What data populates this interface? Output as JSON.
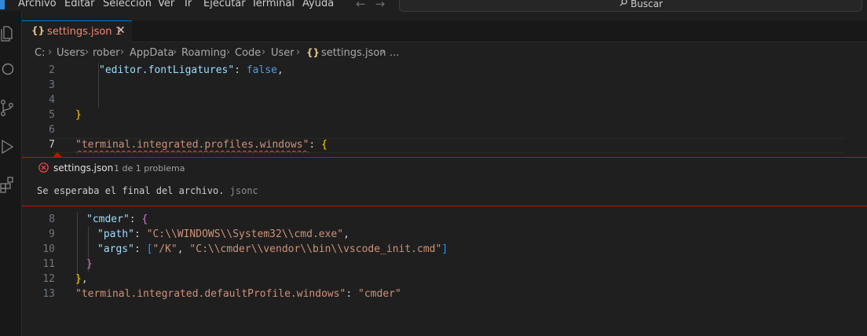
{
  "menubar": {
    "items": [
      "Archivo",
      "Editar",
      "Selección",
      "Ver",
      "Ir",
      "Ejecutar",
      "Terminal",
      "Ayuda"
    ]
  },
  "nav": {
    "back_icon": "arrow-left-icon",
    "forward_icon": "arrow-right-icon"
  },
  "search": {
    "label": "Buscar",
    "icon": "search-icon"
  },
  "activitybar": {
    "icons": [
      "files-icon",
      "search-icon",
      "source-control-icon",
      "run-debug-icon",
      "extensions-icon"
    ]
  },
  "tab": {
    "braces": "{}",
    "name": "settings.json 1",
    "close": "✕"
  },
  "breadcrumb": {
    "parts": [
      "C:",
      "Users",
      "rober",
      "AppData",
      "Roaming",
      "Code",
      "User"
    ],
    "file_braces": "{}",
    "file": "settings.json",
    "more": "..."
  },
  "editor": {
    "lines": [
      {
        "n": "2",
        "tokens": [
          [
            "k",
            "\"editor.fontLigatures\""
          ],
          [
            "p",
            ": "
          ],
          [
            "kw",
            "false"
          ],
          [
            "p",
            ","
          ]
        ]
      },
      {
        "n": "3",
        "tokens": []
      },
      {
        "n": "4",
        "tokens": []
      },
      {
        "n": "5",
        "tokens": [
          [
            "b1",
            "}"
          ]
        ]
      },
      {
        "n": "6",
        "tokens": []
      },
      {
        "n": "7",
        "tokens": [
          [
            "s",
            "\"terminal.integrated.profiles.windows\""
          ],
          [
            "p",
            ": "
          ],
          [
            "b1",
            "{"
          ]
        ]
      },
      {
        "n": "8",
        "tokens": [
          [
            "k",
            "\"cmder\""
          ],
          [
            "p",
            ": "
          ],
          [
            "b2",
            "{"
          ]
        ]
      },
      {
        "n": "9",
        "tokens": [
          [
            "k",
            "\"path\""
          ],
          [
            "p",
            ": "
          ],
          [
            "s",
            "\"C:\\\\WINDOWS\\\\System32\\\\cmd.exe\""
          ],
          [
            "p",
            ","
          ]
        ]
      },
      {
        "n": "10",
        "tokens": [
          [
            "k",
            "\"args\""
          ],
          [
            "p",
            ": "
          ],
          [
            "b3",
            "["
          ],
          [
            "s",
            "\"/K\""
          ],
          [
            "p",
            ", "
          ],
          [
            "s",
            "\"C:\\\\cmder\\\\vendor\\\\bin\\\\vscode_init.cmd\""
          ],
          [
            "b3",
            "]"
          ]
        ]
      },
      {
        "n": "11",
        "tokens": [
          [
            "b2",
            "}"
          ]
        ]
      },
      {
        "n": "12",
        "tokens": [
          [
            "b1",
            "}"
          ],
          [
            "p",
            ","
          ]
        ]
      },
      {
        "n": "13",
        "tokens": [
          [
            "s",
            "\"terminal.integrated.defaultProfile.windows\""
          ],
          [
            "p",
            ": "
          ],
          [
            "s",
            "\"cmder\""
          ]
        ]
      }
    ]
  },
  "problem": {
    "file": "settings.json",
    "count": "1 de 1 problema",
    "message": "Se esperaba el final del archivo.",
    "source": "jsonc"
  },
  "colors": {
    "accent": "#0078d4",
    "error": "#be1100"
  }
}
